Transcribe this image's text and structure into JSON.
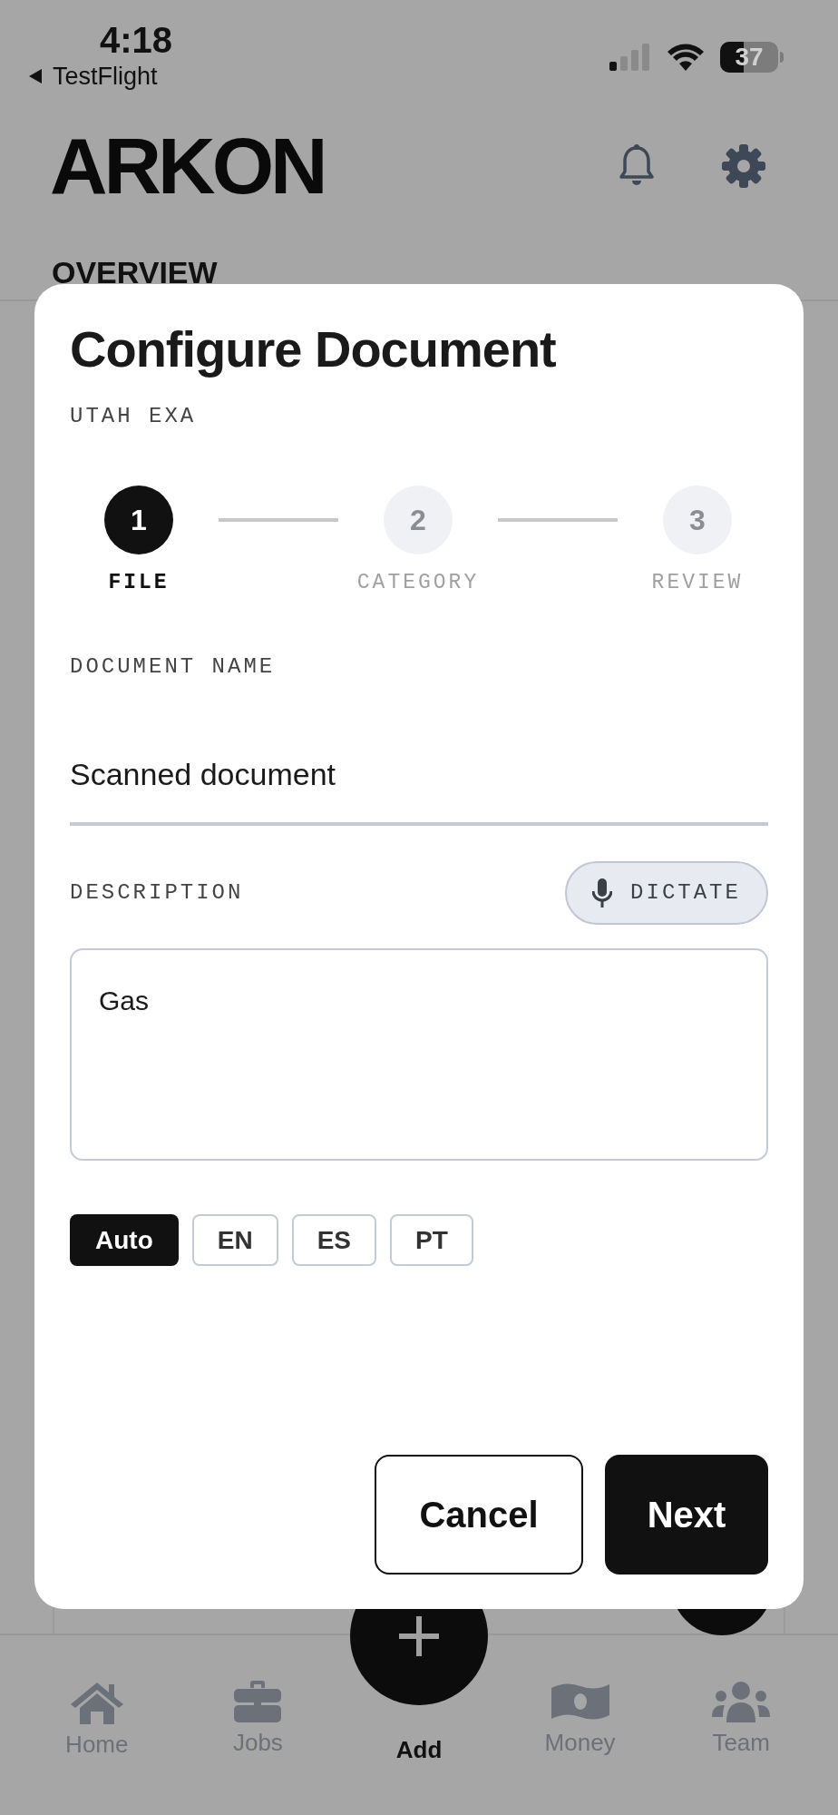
{
  "status_bar": {
    "time": "4:18",
    "back_label": "TestFlight",
    "battery": "37"
  },
  "header": {
    "logo": "ARKON"
  },
  "section_title": "OVERVIEW",
  "dialog": {
    "title": "Configure Document",
    "subtitle": "UTAH EXA",
    "steps": [
      {
        "number": "1",
        "label": "FILE",
        "selected": true
      },
      {
        "number": "2",
        "label": "CATEGORY",
        "selected": false
      },
      {
        "number": "3",
        "label": "REVIEW",
        "selected": false
      }
    ],
    "name_field": {
      "label": "DOCUMENT NAME",
      "value": "Scanned document"
    },
    "description": {
      "label": "DESCRIPTION",
      "dictate_button": "DICTATE",
      "value": "Gas"
    },
    "languages": [
      {
        "label": "Auto",
        "selected": true
      },
      {
        "label": "EN",
        "selected": false
      },
      {
        "label": "ES",
        "selected": false
      },
      {
        "label": "PT",
        "selected": false
      }
    ],
    "buttons": {
      "cancel": "Cancel",
      "next": "Next"
    }
  },
  "tab_bar": [
    {
      "kind": "home",
      "label": "Home",
      "selected": false
    },
    {
      "kind": "jobs",
      "label": "Jobs",
      "selected": false
    },
    {
      "kind": "add",
      "label": "Add",
      "selected": true
    },
    {
      "kind": "money",
      "label": "Money",
      "selected": false
    },
    {
      "kind": "team",
      "label": "Team",
      "selected": false
    }
  ]
}
